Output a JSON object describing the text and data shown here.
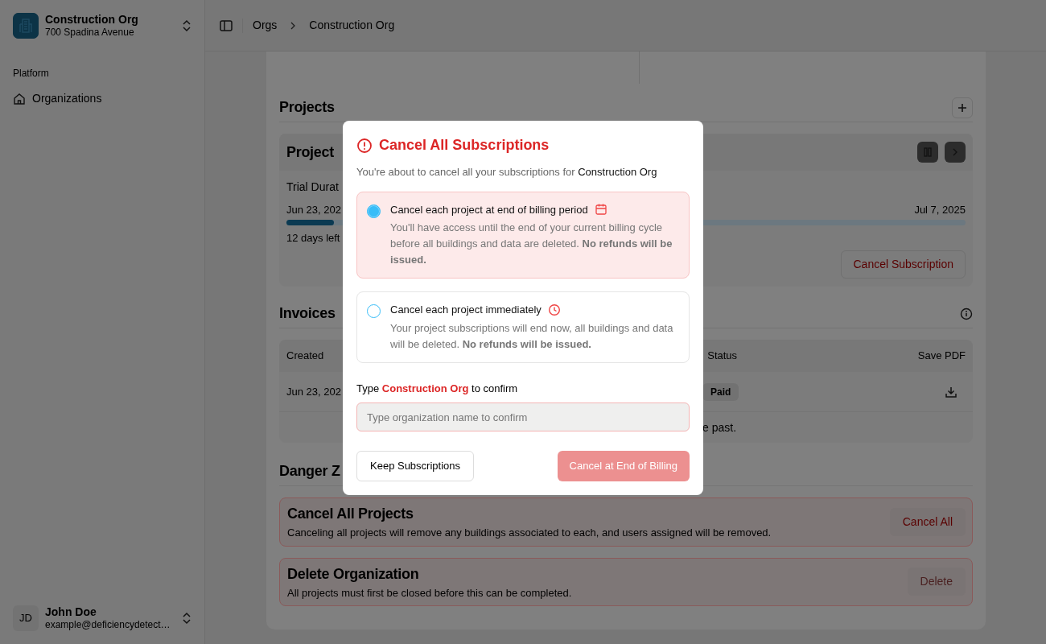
{
  "sidebar": {
    "org": {
      "name": "Construction Org",
      "address": "700 Spadina Avenue"
    },
    "section_label": "Platform",
    "items": [
      {
        "label": "Organizations",
        "selected": false
      }
    ],
    "user": {
      "initials": "JD",
      "name": "John Doe",
      "email": "example@deficiencydetect…"
    }
  },
  "breadcrumb": [
    "Orgs",
    "Construction Org"
  ],
  "projects": {
    "title": "Projects",
    "card": {
      "title": "Project",
      "trial_label": "Trial Durat",
      "start": "Jun 23, 202",
      "end": "Jul 7, 2025",
      "level": 0.07,
      "remaining": "12 days left",
      "cancel_button": "Cancel Subscription"
    }
  },
  "invoices": {
    "title": "Invoices",
    "columns": [
      "Created",
      "Status",
      "Save PDF"
    ],
    "rows": [
      {
        "created": "Jun 23, 202",
        "status": "Paid"
      }
    ],
    "footer": "e past."
  },
  "danger_zone": {
    "title": "Danger Z",
    "items": [
      {
        "title": "Cancel All Projects",
        "description": "Canceling all projects will remove any buildings associated to each, and users assigned will be removed.",
        "button": "Cancel All",
        "disabled": false
      },
      {
        "title": "Delete Organization",
        "description": "All projects must first be closed before this can be completed.",
        "button": "Delete",
        "disabled": true
      }
    ]
  },
  "dialog": {
    "title": "Cancel All Subscriptions",
    "intro": "You're about to cancel all your subscriptions for",
    "org_name": "Construction Org",
    "options": [
      {
        "kind": "end_of_period",
        "label": "Cancel each project at end of billing period",
        "description": "You'll have access until the end of your current billing cycle before all buildings and data are deleted. **No refunds will be issued.**",
        "selected": true
      },
      {
        "kind": "immediate",
        "label": "Cancel each project immediately",
        "description": "Your project subscriptions will end now, all buildings and data will be deleted. **No refunds will be issued.**",
        "selected": false
      }
    ],
    "confirm": {
      "prefix": "Type",
      "name": "Construction Org",
      "suffix": "to confirm",
      "placeholder": "Type organization name to confirm"
    },
    "keep_button": "Keep Subscriptions",
    "confirm_button": {
      "label": "Cancel at End of Billing",
      "disabled": true
    }
  }
}
